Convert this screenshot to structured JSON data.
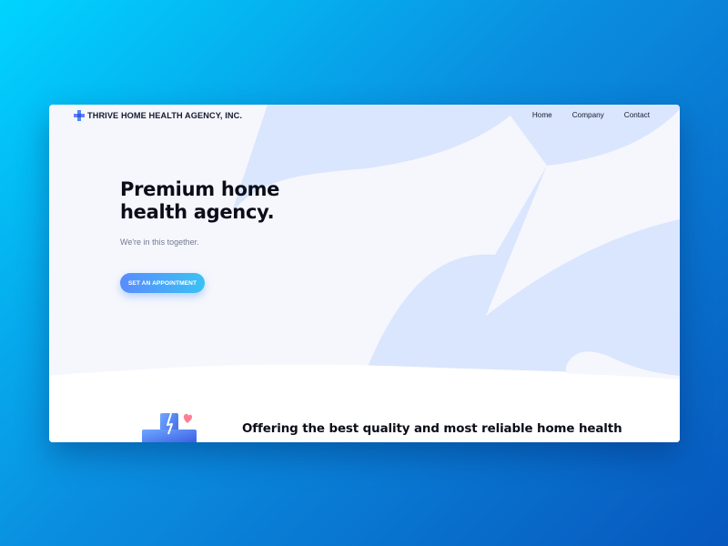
{
  "header": {
    "logo_text": "THRIVE HOME HEALTH AGENCY, INC.",
    "logo_icon": "medical-cross-icon",
    "nav": [
      "Home",
      "Company",
      "Contact"
    ]
  },
  "hero": {
    "title_line1": "Premium home",
    "title_line2": "health agency.",
    "subtitle": "We're in this together.",
    "cta_label": "SET AN APPOINTMENT"
  },
  "services": {
    "heading": "Offering the best quality and most reliable home health",
    "illustration_icon": "medical-cross-heart-icon"
  },
  "colors": {
    "page_gradient_start": "#00d4ff",
    "page_gradient_end": "#0757bd",
    "hero_background": "#f6f7fd",
    "hero_shape": "#dae6fd",
    "cta_gradient_start": "#5a8cff",
    "cta_gradient_end": "#39c2f3",
    "heading_text": "#0b0d18",
    "muted_text": "#717a90"
  }
}
